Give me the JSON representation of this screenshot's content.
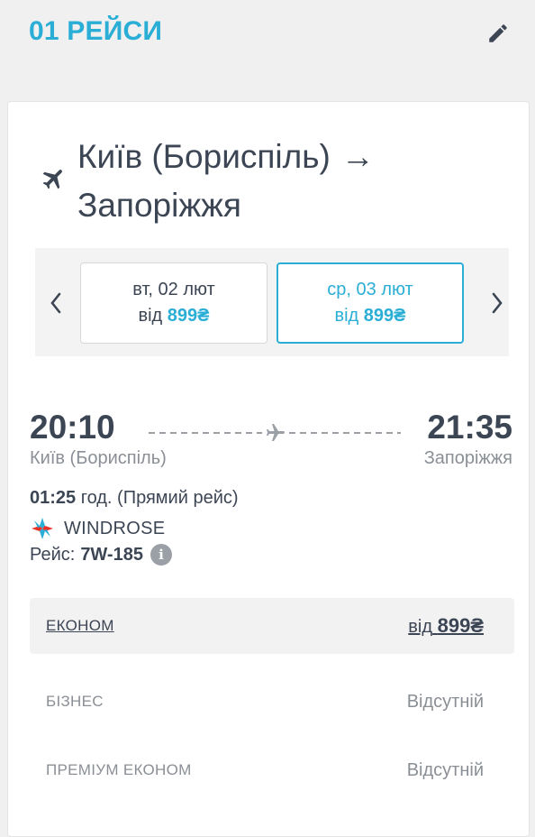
{
  "header": {
    "title": "01 РЕЙСИ",
    "edit_icon": "pencil-icon"
  },
  "route": {
    "icon": "plane-icon",
    "from": "Київ (Бориспіль)",
    "arrow": "→",
    "to": "Запоріжжя"
  },
  "dates": [
    {
      "label": "вт, 02 лют",
      "price_prefix": "від",
      "price": "899₴",
      "selected": false
    },
    {
      "label": "ср, 03 лют",
      "price_prefix": "від",
      "price": "899₴",
      "selected": true
    }
  ],
  "flight": {
    "departure_time": "20:10",
    "departure_city": "Київ (Бориспіль)",
    "arrival_time": "21:35",
    "arrival_city": "Запоріжжя",
    "duration": "01:25",
    "duration_suffix": "год. (Прямий рейс)",
    "airline": "WINDROSE",
    "flight_label": "Рейс:",
    "flight_number": "7W-185",
    "info_icon": "info-icon"
  },
  "fares": [
    {
      "name": "ЕКОНОМ",
      "price_prefix": "від",
      "price": "899₴"
    },
    {
      "name": "БІЗНЕС",
      "price": "Відсутній"
    },
    {
      "name": "ПРЕМІУМ ЕКОНОМ",
      "price": "Відсутній"
    }
  ],
  "colors": {
    "accent": "#2aaed6",
    "text": "#3c4554",
    "muted": "#8a8f96"
  }
}
